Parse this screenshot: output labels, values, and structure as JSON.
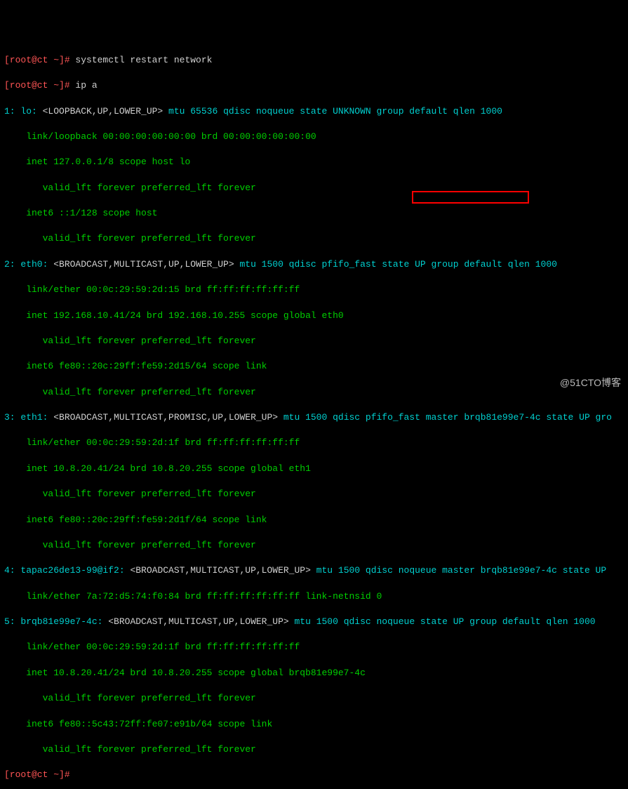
{
  "prompt1": "[root@ct ~]# ",
  "cmd1": "systemctl restart network",
  "prompt2": "[root@ct ~]# ",
  "cmd2": "ip a",
  "if1_hdr_a": "1: lo: ",
  "if1_hdr_b": "<LOOPBACK,UP,LOWER_UP>",
  "if1_hdr_c": " mtu 65536 qdisc noqueue state UNKNOWN group default qlen 1000",
  "if1_l2": "    link/loopback 00:00:00:00:00:00 brd 00:00:00:00:00:00",
  "if1_l3": "    inet 127.0.0.1/8 scope host lo",
  "if1_l4": "       valid_lft forever preferred_lft forever",
  "if1_l5": "    inet6 ::1/128 scope host",
  "if1_l6": "       valid_lft forever preferred_lft forever",
  "if2_hdr_a": "2: eth0: ",
  "if2_hdr_b": "<BROADCAST,MULTICAST,UP,LOWER_UP>",
  "if2_hdr_c": " mtu 1500 qdisc pfifo_fast state UP group default qlen 1000",
  "if2_l2": "    link/ether 00:0c:29:59:2d:15 brd ff:ff:ff:ff:ff:ff",
  "if2_l3": "    inet 192.168.10.41/24 brd 192.168.10.255 scope global eth0",
  "if2_l4": "       valid_lft forever preferred_lft forever",
  "if2_l5": "    inet6 fe80::20c:29ff:fe59:2d15/64 scope link",
  "if2_l6": "       valid_lft forever preferred_lft forever",
  "if3_hdr_a": "3: eth1: ",
  "if3_hdr_b": "<BROADCAST,MULTICAST,PROMISC,UP,LOWER_UP>",
  "if3_hdr_c": " mtu 1500 qdisc pfifo_fast master brqb81e99e7-4c state UP gro",
  "if3_l2": "    link/ether 00:0c:29:59:2d:1f brd ff:ff:ff:ff:ff:ff",
  "if3_l3": "    inet 10.8.20.41/24 brd 10.8.20.255 scope global eth1",
  "if3_l4": "       valid_lft forever preferred_lft forever",
  "if3_l5": "    inet6 fe80::20c:29ff:fe59:2d1f/64 scope link",
  "if3_l6": "       valid_lft forever preferred_lft forever",
  "if4_hdr_a": "4: tapac26de13-99@if2: ",
  "if4_hdr_b": "<BROADCAST,MULTICAST,UP,LOWER_UP>",
  "if4_hdr_c": " mtu 1500 qdisc noqueue master brqb81e99e7-4c state UP ",
  "if4_l2": "    link/ether 7a:72:d5:74:f0:84 brd ff:ff:ff:ff:ff:ff link-netnsid 0",
  "if5_hdr_a": "5: brqb81e99e7-4c: ",
  "if5_hdr_b": "<BROADCAST,MULTICAST,UP,LOWER_UP>",
  "if5_hdr_c": " mtu 1500 qdisc noqueue state UP group default qlen 1000",
  "if5_l2": "    link/ether 00:0c:29:59:2d:1f brd ff:ff:ff:ff:ff:ff",
  "if5_l3": "    inet 10.8.20.41/24 brd 10.8.20.255 scope global brqb81e99e7-4c",
  "if5_l4": "       valid_lft forever preferred_lft forever",
  "if5_l5": "    inet6 fe80::5c43:72ff:fe07:e91b/64 scope link",
  "if5_l6": "       valid_lft forever preferred_lft forever",
  "prompt3": "[root@ct ~]# ",
  "watermark": "@51CTO博客"
}
